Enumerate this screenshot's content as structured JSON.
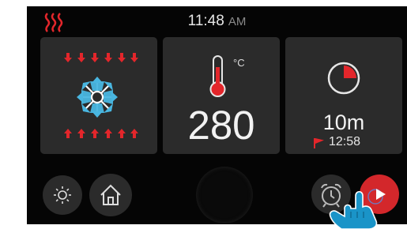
{
  "status_bar": {
    "time": "11:48",
    "ampm": "AM",
    "heat_icon": "heat-waves-icon"
  },
  "tiles": {
    "mode": {
      "icon": "convection-fan-top-bottom-heat-icon"
    },
    "temperature": {
      "unit": "°C",
      "value": "280",
      "icon": "thermometer-icon"
    },
    "timer": {
      "duration": "10m",
      "end_time": "12:58",
      "icon": "timer-pie-icon",
      "flag_icon": "flag-icon"
    }
  },
  "buttons": {
    "brightness": "brightness-icon",
    "home": "home-icon",
    "alarm": "alarm-clock-icon",
    "start": "play-icon"
  },
  "colors": {
    "background": "#050505",
    "tile": "#2b2b2b",
    "accent_red": "#e3262b",
    "fan_blue": "#49b6e0",
    "text": "#f2f2f2"
  }
}
